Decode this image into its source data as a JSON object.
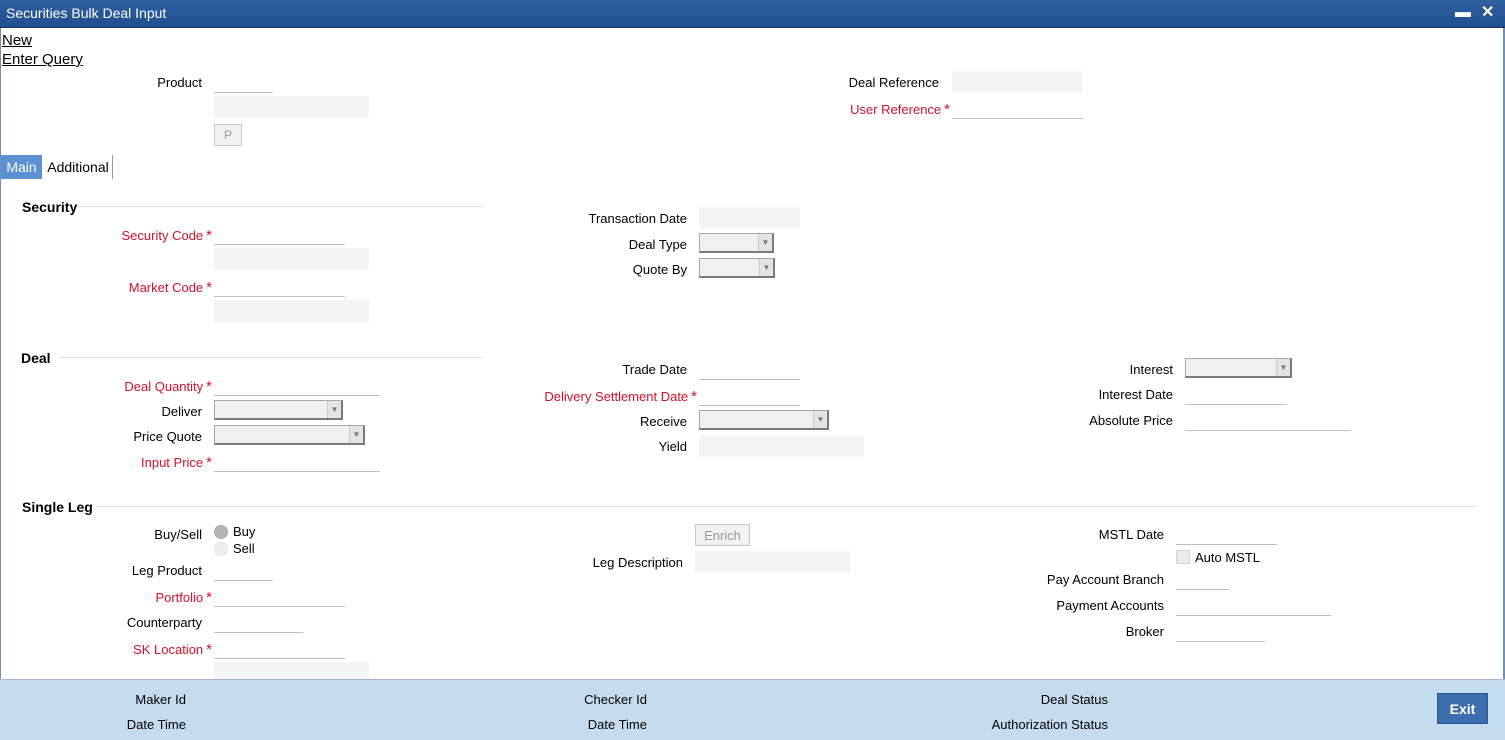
{
  "window": {
    "title": "Securities Bulk Deal Input",
    "minimize_glyph": "▬",
    "close_glyph": "✕"
  },
  "menu": {
    "new": "New",
    "enter_query": "Enter Query"
  },
  "header": {
    "product_label": "Product",
    "product_button": "P",
    "deal_reference_label": "Deal Reference",
    "user_reference_label": "User Reference"
  },
  "tabs": [
    {
      "label": "Main"
    },
    {
      "label": "Additional"
    }
  ],
  "required_marker": "*",
  "security": {
    "title": "Security",
    "security_code_label": "Security Code",
    "market_code_label": "Market Code",
    "transaction_date_label": "Transaction Date",
    "deal_type_label": "Deal Type",
    "quote_by_label": "Quote By"
  },
  "deal": {
    "title": "Deal",
    "deal_quantity_label": "Deal Quantity",
    "deliver_label": "Deliver",
    "price_quote_label": "Price Quote",
    "input_price_label": "Input Price",
    "trade_date_label": "Trade Date",
    "delivery_settlement_date_label": "Delivery Settlement Date",
    "receive_label": "Receive",
    "yield_label": "Yield",
    "interest_label": "Interest",
    "interest_date_label": "Interest Date",
    "absolute_price_label": "Absolute Price"
  },
  "single_leg": {
    "title": "Single Leg",
    "buy_sell_label": "Buy/Sell",
    "buy_label": "Buy",
    "sell_label": "Sell",
    "leg_product_label": "Leg Product",
    "portfolio_label": "Portfolio",
    "counterparty_label": "Counterparty",
    "sk_location_label": "SK Location",
    "enrich_button": "Enrich",
    "leg_description_label": "Leg Description",
    "mstl_date_label": "MSTL Date",
    "auto_mstl_label": "Auto MSTL",
    "pay_account_branch_label": "Pay Account Branch",
    "payment_accounts_label": "Payment Accounts",
    "broker_label": "Broker"
  },
  "footer": {
    "maker_id_label": "Maker Id",
    "maker_date_time_label": "Date Time",
    "checker_id_label": "Checker Id",
    "checker_date_time_label": "Date Time",
    "deal_status_label": "Deal Status",
    "authorization_status_label": "Authorization Status",
    "exit_button": "Exit"
  },
  "colors": {
    "title_bar": "#2f5f9f",
    "required_label": "#d0112b",
    "active_tab": "#5b90d1",
    "footer": "#c5dcef",
    "exit_button": "#3d6fae"
  }
}
